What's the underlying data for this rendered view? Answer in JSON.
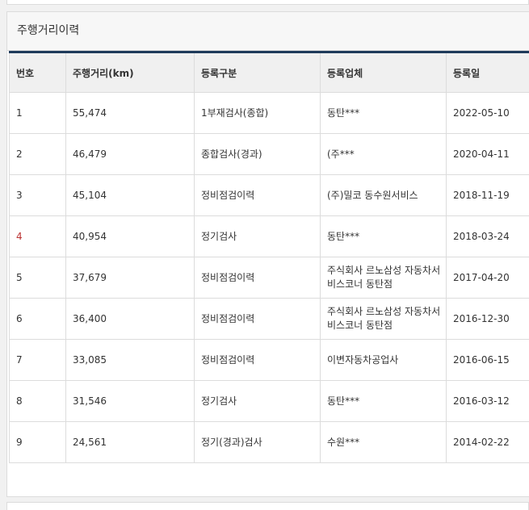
{
  "section": {
    "title": "주행거리이력"
  },
  "table": {
    "headers": [
      "번호",
      "주행거리(km)",
      "등록구분",
      "등록업체",
      "등록일"
    ],
    "rows": [
      [
        "1",
        "55,474",
        "1부재검사(종합)",
        "동탄***",
        "2022-05-10"
      ],
      [
        "2",
        "46,479",
        "종합검사(경과)",
        "(주***",
        "2020-04-11"
      ],
      [
        "3",
        "45,104",
        "정비점검이력",
        "(주)밀코 동수원서비스",
        "2018-11-19"
      ],
      [
        "4",
        "40,954",
        "정기검사",
        "동탄***",
        "2018-03-24"
      ],
      [
        "5",
        "37,679",
        "정비점검이력",
        "주식회사 르노삼성 자동차서비스코너 동탄점",
        "2017-04-20"
      ],
      [
        "6",
        "36,400",
        "정비점검이력",
        "주식회사 르노삼성 자동차서비스코너 동탄점",
        "2016-12-30"
      ],
      [
        "7",
        "33,085",
        "정비점검이력",
        "이변자동차공업사",
        "2016-06-15"
      ],
      [
        "8",
        "31,546",
        "정기검사",
        "동탄***",
        "2016-03-12"
      ],
      [
        "9",
        "24,561",
        "정기(경과)검사",
        "수원***",
        "2014-02-22"
      ]
    ]
  }
}
